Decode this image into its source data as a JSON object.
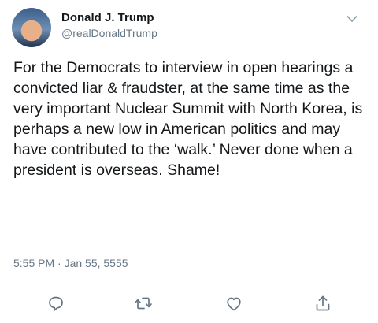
{
  "author": {
    "display_name": "Donald J. Trump",
    "handle": "@realDonaldTrump",
    "avatar_icon": "profile-photo"
  },
  "tweet": {
    "text": "For the Democrats to interview in open hearings a convicted liar & fraudster, at the same time as the very important Nuclear Summit with North Korea, is perhaps a new low in American politics and may have contributed to the ‘walk.’ Never done when a president is overseas. Shame!",
    "timestamp": "5:55 PM · Jan 55, 5555"
  },
  "actions": [
    {
      "name": "reply",
      "icon": "speech-bubble-icon"
    },
    {
      "name": "retweet",
      "icon": "retweet-arrows-icon"
    },
    {
      "name": "like",
      "icon": "heart-outline-icon"
    },
    {
      "name": "share",
      "icon": "share-upload-icon"
    }
  ],
  "colors": {
    "primary_text": "#14171a",
    "secondary_text": "#657786",
    "divider": "#e1e8ed"
  }
}
